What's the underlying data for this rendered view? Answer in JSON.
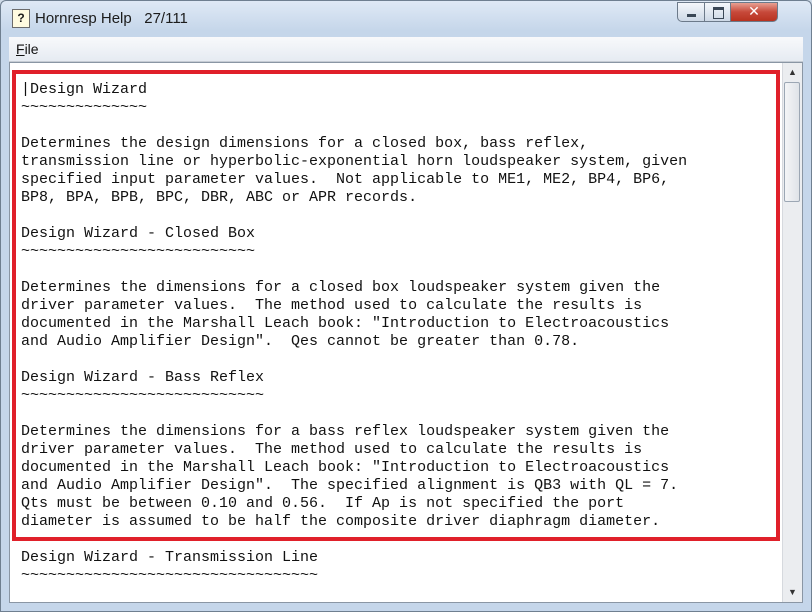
{
  "window": {
    "title": "Hornresp Help",
    "page_indicator": "27/111",
    "app_icon_glyph": "?"
  },
  "menu": {
    "items": [
      {
        "label": "File",
        "accelerator": "F"
      }
    ]
  },
  "content": {
    "lines": [
      "|Design Wizard",
      "~~~~~~~~~~~~~~",
      "",
      "Determines the design dimensions for a closed box, bass reflex,",
      "transmission line or hyperbolic-exponential horn loudspeaker system, given",
      "specified input parameter values.  Not applicable to ME1, ME2, BP4, BP6,",
      "BP8, BPA, BPB, BPC, DBR, ABC or APR records.",
      "",
      "Design Wizard - Closed Box",
      "~~~~~~~~~~~~~~~~~~~~~~~~~~",
      "",
      "Determines the dimensions for a closed box loudspeaker system given the",
      "driver parameter values.  The method used to calculate the results is",
      "documented in the Marshall Leach book: \"Introduction to Electroacoustics",
      "and Audio Amplifier Design\".  Qes cannot be greater than 0.78.",
      "",
      "Design Wizard - Bass Reflex",
      "~~~~~~~~~~~~~~~~~~~~~~~~~~~",
      "",
      "Determines the dimensions for a bass reflex loudspeaker system given the",
      "driver parameter values.  The method used to calculate the results is",
      "documented in the Marshall Leach book: \"Introduction to Electroacoustics",
      "and Audio Amplifier Design\".  The specified alignment is QB3 with QL = 7.",
      "Qts must be between 0.10 and 0.56.  If Ap is not specified the port",
      "diameter is assumed to be half the composite driver diaphragm diameter.",
      "",
      "Design Wizard - Transmission Line",
      "~~~~~~~~~~~~~~~~~~~~~~~~~~~~~~~~~"
    ]
  },
  "colors": {
    "highlight": "#e0202a",
    "window_frame": "#c5d6ea",
    "close_button": "#c7493a"
  },
  "icons": {
    "minimize": "minimize-icon",
    "maximize": "maximize-icon",
    "close": "close-icon",
    "scroll_up": "arrow-up-icon",
    "scroll_down": "arrow-down-icon"
  }
}
